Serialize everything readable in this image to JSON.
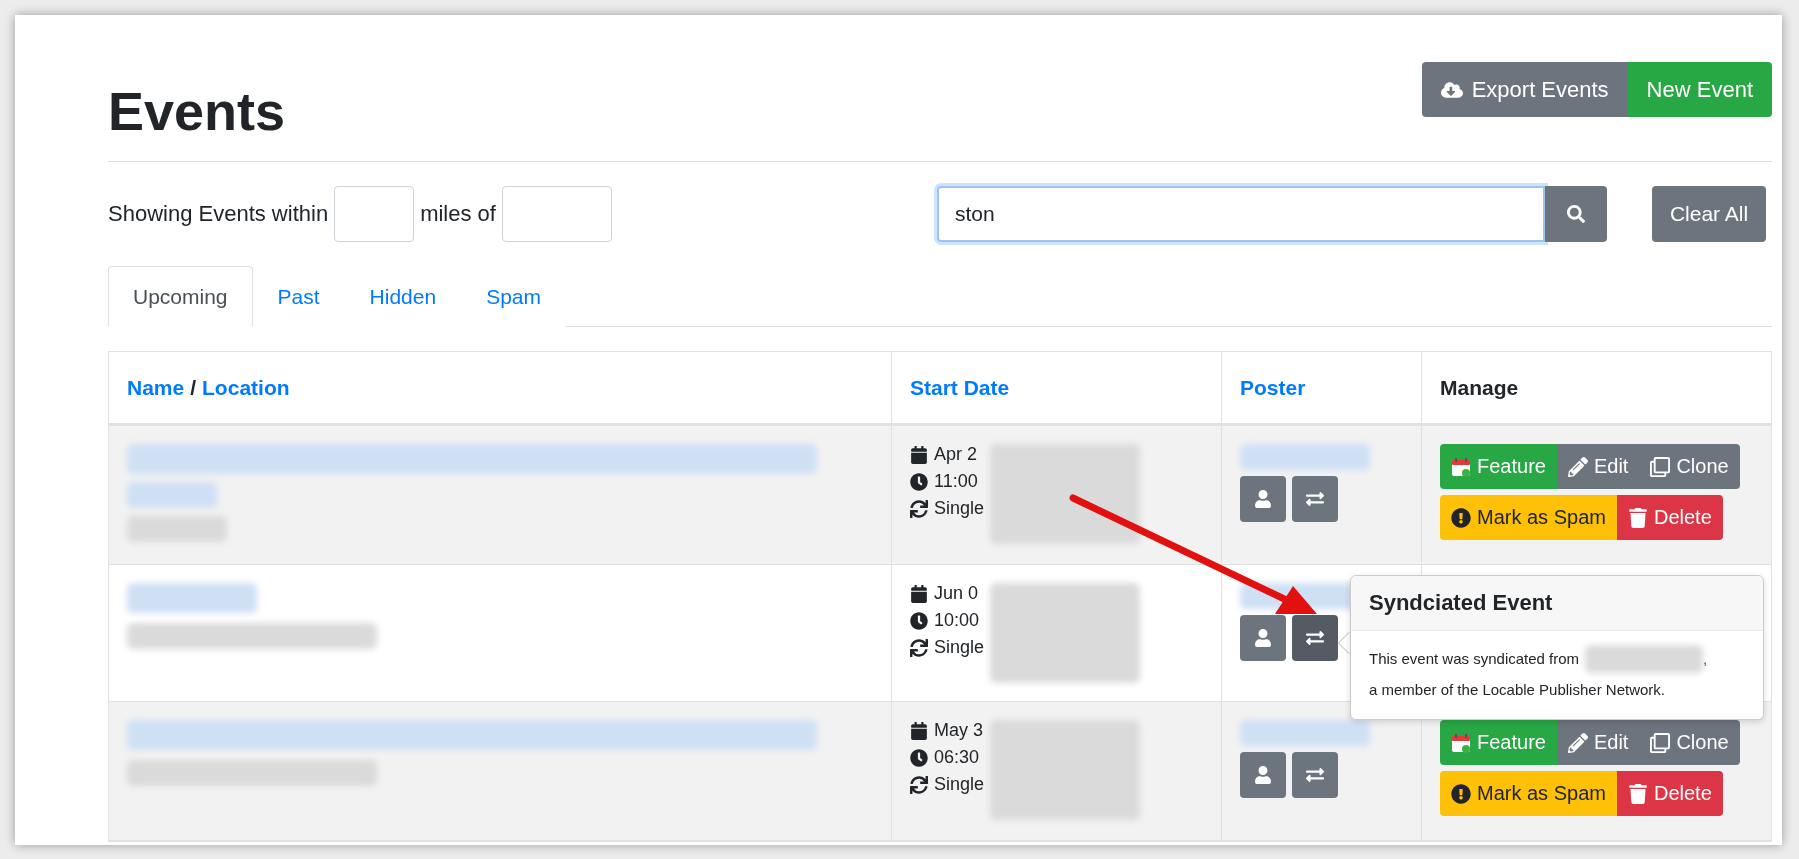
{
  "page": {
    "title": "Events"
  },
  "header_buttons": [
    {
      "label": "Export Events",
      "kind": "export"
    },
    {
      "label": "New Event",
      "kind": "new"
    }
  ],
  "filter": {
    "label_before": "Showing Events within",
    "label_middle": "miles of",
    "search_value": "ston",
    "clear_button": "Clear All"
  },
  "tabs": [
    {
      "label": "Upcoming",
      "selected": true
    },
    {
      "label": "Past",
      "selected": false
    },
    {
      "label": "Hidden",
      "selected": false
    },
    {
      "label": "Spam",
      "selected": false
    }
  ],
  "table": {
    "name_column": {
      "name": "Name",
      "separator": "/",
      "location": "Location"
    },
    "columns": [
      {
        "label": "Start Date",
        "link": true
      },
      {
        "label": "Poster",
        "link": true
      },
      {
        "label": "Manage",
        "link": false
      }
    ],
    "rows": [
      {
        "shaded": true,
        "date": "Apr 2",
        "time": "11:00",
        "recurrence": "Single",
        "sync_active": false,
        "manage": [
          [
            {
              "label": "Feature",
              "kind": "feature"
            },
            {
              "label": "Edit",
              "kind": "edit"
            },
            {
              "label": "Clone",
              "kind": "clone"
            }
          ],
          [
            {
              "label": "Mark as Spam",
              "kind": "spam"
            },
            {
              "label": "Delete",
              "kind": "delete"
            }
          ]
        ]
      },
      {
        "shaded": false,
        "date": "Jun 0",
        "time": "10:00",
        "recurrence": "Single",
        "sync_active": true
      },
      {
        "shaded": true,
        "date": "May 3",
        "time": "06:30",
        "recurrence": "Single",
        "sync_active": false,
        "manage": [
          [
            {
              "label": "Feature",
              "kind": "feature"
            },
            {
              "label": "Edit",
              "kind": "edit"
            },
            {
              "label": "Clone",
              "kind": "clone"
            }
          ],
          [
            {
              "label": "Mark as Spam",
              "kind": "spam"
            },
            {
              "label": "Delete",
              "kind": "delete"
            }
          ]
        ]
      }
    ]
  },
  "popover": {
    "title": "Syndciated Event",
    "body": [
      "This event was syndicated from",
      ",",
      "a member of the Locable Publisher Network."
    ]
  }
}
